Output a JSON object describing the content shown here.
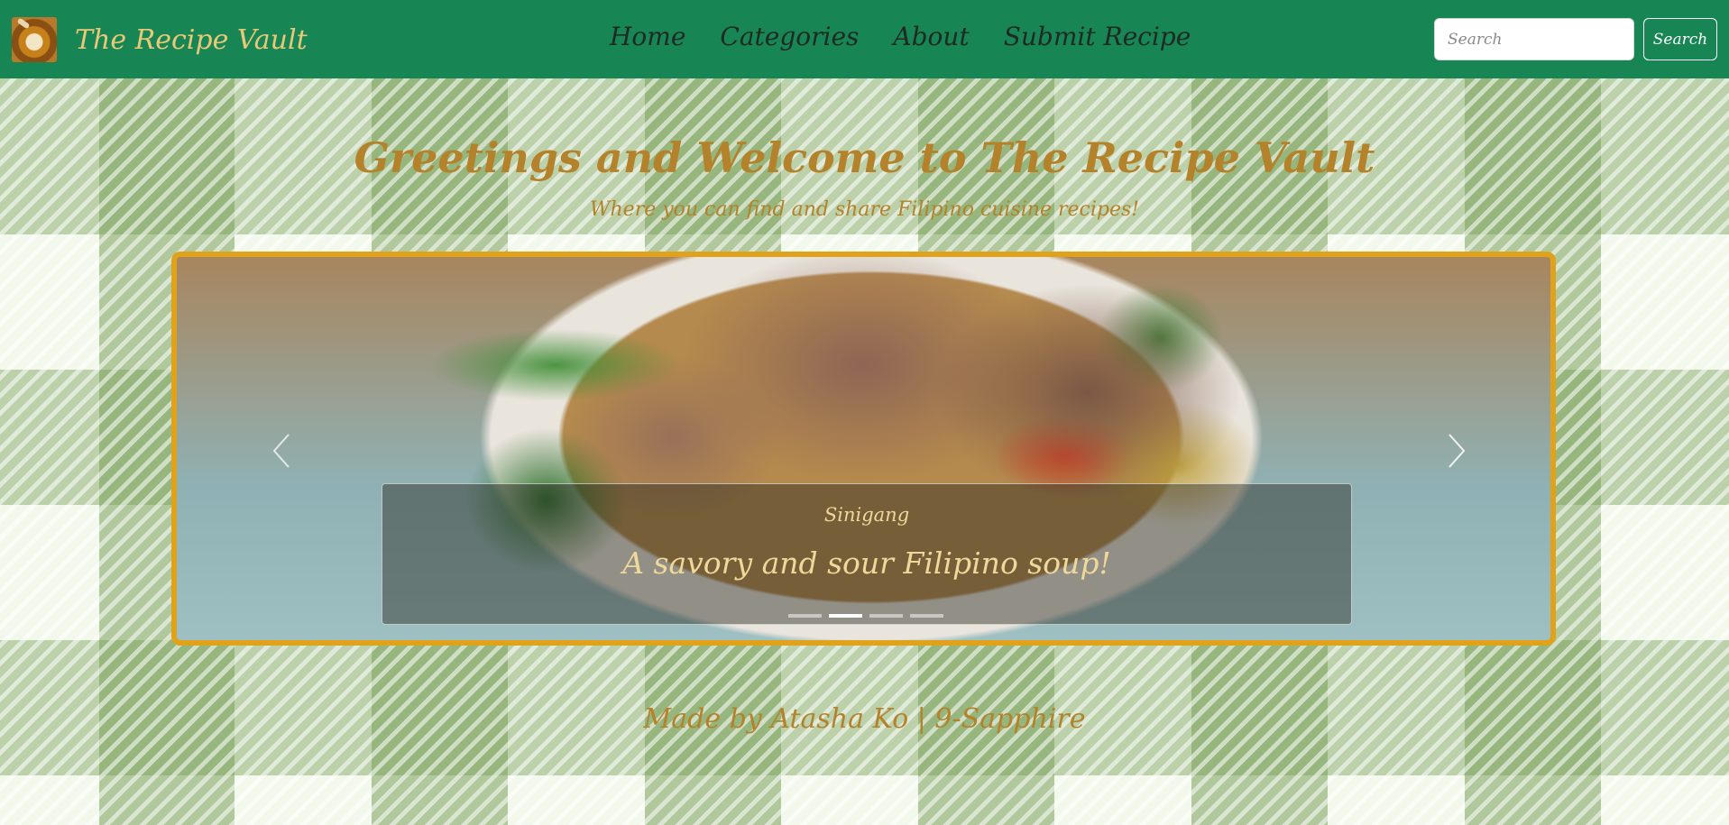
{
  "navbar": {
    "logo_icon": "cooking-pot-icon",
    "brand": "The Recipe Vault",
    "links": [
      "Home",
      "Categories",
      "About",
      "Submit Recipe"
    ],
    "search_placeholder": "Search",
    "search_button": "Search",
    "colors": {
      "bar": "#178554",
      "brand_text": "#e8c978"
    }
  },
  "hero": {
    "title": "Greetings and Welcome to The Recipe Vault",
    "subtitle": "Where you can find and share Filipino cuisine recipes!",
    "accent_color": "#b3822a"
  },
  "carousel": {
    "slide_title": "Sinigang",
    "slide_text": "A savory and sour Filipino soup!",
    "indicator_count": 4,
    "active_indicator": 2,
    "prev_icon": "chevron-left-icon",
    "next_icon": "chevron-right-icon",
    "border_color": "#e0a21a"
  },
  "footer": {
    "text": "Made by Atasha Ko | 9-Sapphire"
  }
}
